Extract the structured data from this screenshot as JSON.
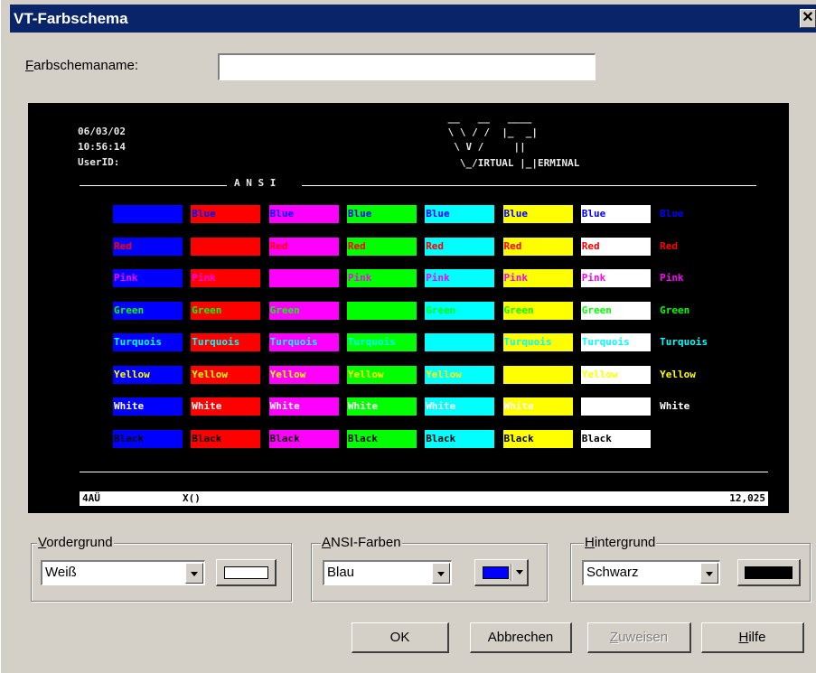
{
  "window": {
    "title": "VT-Farbschema",
    "close_glyph": "✕"
  },
  "scheme_name": {
    "label_mnemonic": "F",
    "label_rest": "arbschemaname:",
    "value": ""
  },
  "terminal": {
    "date": "06/03/02",
    "time": "10:56:14",
    "userid": "UserID:",
    "ansi_label": "A N S I",
    "logo_lines": [
      " __   __   ____ ",
      " \\ \\ / /  |_  _|",
      "  \\ V /     ||  ",
      "   \\_/IRTUAL |_|ERMINAL"
    ],
    "status_left1": "4AÜ",
    "status_left2": "X()",
    "status_right": "12,025",
    "color_names": [
      "Blue",
      "Red",
      "Pink",
      "Green",
      "Turquois",
      "Yellow",
      "White",
      "Black"
    ],
    "palette": {
      "Blue": "#0000ff",
      "Red": "#ff0000",
      "Pink": "#ff00ff",
      "Green": "#00ff00",
      "Turquois": "#00ffff",
      "Yellow": "#ffff00",
      "White": "#ffffff",
      "Black": "#000000"
    }
  },
  "foreground": {
    "label_mnemonic": "V",
    "label_rest": "ordergrund",
    "value": "Weiß",
    "swatch_color": "#ffffff"
  },
  "ansi": {
    "label_mnemonic": "A",
    "label_rest": "NSI-Farben",
    "value": "Blau",
    "swatch_color": "#0000ff"
  },
  "background": {
    "label_mnemonic": "H",
    "label_rest": "intergrund",
    "value": "Schwarz",
    "swatch_color": "#000000"
  },
  "buttons": {
    "ok": "OK",
    "cancel": "Abbrechen",
    "assign_mnemonic": "Z",
    "assign_rest": "uweisen",
    "help_mnemonic": "H",
    "help_rest": "ilfe"
  }
}
